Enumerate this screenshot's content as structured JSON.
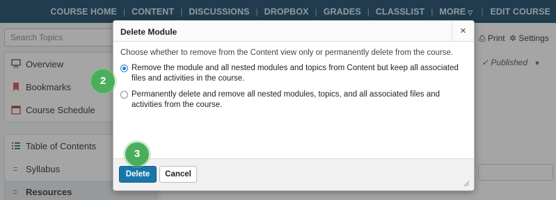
{
  "navbar": {
    "items": [
      "COURSE HOME",
      "CONTENT",
      "DISCUSSIONS",
      "DROPBOX",
      "GRADES",
      "CLASSLIST",
      "MORE"
    ],
    "edit_course": "EDIT COURSE"
  },
  "sidebar": {
    "search_placeholder": "Search Topics",
    "items": [
      "Overview",
      "Bookmarks",
      "Course Schedule"
    ],
    "toc_label": "Table of Contents",
    "modules": [
      "Syllabus",
      "Resources"
    ]
  },
  "main": {
    "print_label": "Print",
    "settings_label": "Settings",
    "status": "Published"
  },
  "dialog": {
    "title": "Delete Module",
    "close": "×",
    "intro": "Choose whether to remove from the Content view only or permanently delete from the course.",
    "options": [
      {
        "label": "Remove the module and all nested modules and topics from Content but keep all associated files and activities in the course.",
        "checked": true
      },
      {
        "label": "Permanently delete and remove all nested modules, topics, and all associated files and activities from the course.",
        "checked": false
      }
    ],
    "delete_label": "Delete",
    "cancel_label": "Cancel"
  },
  "steps": [
    "2",
    "3"
  ],
  "colors": {
    "navbar": "#1a4a6a",
    "primary_button": "#1a76a8",
    "step_badge": "#4cae5c",
    "radio_selected": "#2a7bd6"
  }
}
